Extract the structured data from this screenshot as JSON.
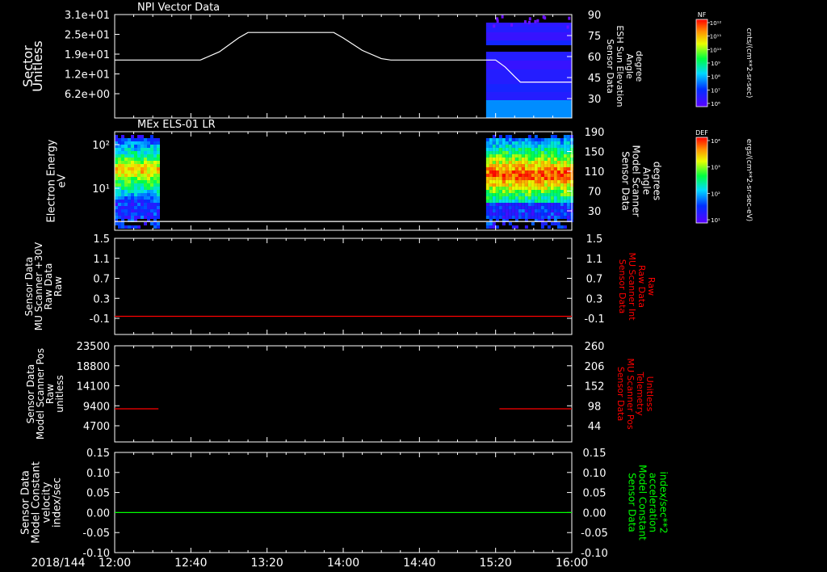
{
  "chart_data": [
    {
      "type": "line",
      "title": "NPI Vector Data",
      "ylabel_left": [
        "Sector",
        "Unitless"
      ],
      "ylabel_right": [
        "Sensor Data",
        "ESH Sun Elevation",
        "Angle",
        "degree"
      ],
      "yticks_left": [
        "3.1e+01",
        "2.5e+01",
        "1.9e+01",
        "1.2e+01",
        "6.2e+00"
      ],
      "yticks_right": [
        "90",
        "75",
        "60",
        "45",
        "30"
      ],
      "ylim_right": [
        15,
        90
      ],
      "series": [
        {
          "color": "#ffffff",
          "x": [
            "12:00",
            "12:35",
            "12:45",
            "12:55",
            "13:05",
            "13:10",
            "13:55",
            "14:00",
            "14:10",
            "14:20",
            "14:25",
            "15:20",
            "15:25",
            "15:30",
            "15:33",
            "16:00"
          ],
          "values": [
            57,
            57,
            57,
            63,
            73,
            77,
            77,
            73,
            64,
            58,
            57,
            57,
            52,
            45,
            41,
            41
          ]
        }
      ],
      "spectrogram": {
        "start": "15:15",
        "end": "16:00",
        "colorbar": "NF"
      },
      "colorbar": {
        "label": "NF",
        "ticks": [
          "10¹²",
          "10¹¹",
          "10¹⁰",
          "10⁹",
          "10⁸",
          "10⁷",
          "10⁶"
        ],
        "units": "cnts/(cm**2-sr-sec)"
      }
    },
    {
      "type": "heatmap",
      "title": "MEx ELS-01 LR",
      "ylabel_left": [
        "Electron Energy",
        "eV"
      ],
      "ylabel_right": [
        "Sensor Data",
        "Model Scanner",
        "Angle",
        "degrees"
      ],
      "yticks_left": [
        "10²",
        "10¹"
      ],
      "yticks_right": [
        "190",
        "150",
        "110",
        "70",
        "30"
      ],
      "ylim_right": [
        0,
        190
      ],
      "blocks": [
        {
          "start": "12:00",
          "end": "12:23"
        },
        {
          "start": "15:15",
          "end": "16:00"
        }
      ],
      "series": [
        {
          "color": "#ffffff",
          "x": [
            "12:00",
            "16:00"
          ],
          "values": [
            17,
            17
          ]
        }
      ],
      "colorbar": {
        "label": "DEF",
        "ticks": [
          "10⁴",
          "10³",
          "10²",
          "10¹"
        ],
        "units": "ergs/(cm**2-sr-sec-eV)"
      }
    },
    {
      "type": "line",
      "ylabel_left": [
        "Sensor Data",
        "MU Scanner +30V",
        "Raw Data",
        "Raw"
      ],
      "ylabel_right": [
        "Sensor Data",
        "MU Scanner Int",
        "Raw Data",
        "Raw"
      ],
      "ylabel_right_color": "#ff0000",
      "yticks_left": [
        "1.5",
        "1.1",
        "0.7",
        "0.3",
        "-0.1"
      ],
      "yticks_right": [
        "1.5",
        "1.1",
        "0.7",
        "0.3",
        "-0.1"
      ],
      "ylim": [
        -0.35,
        1.5
      ],
      "series": [
        {
          "color": "#ff0000",
          "x": [
            "12:00",
            "16:00"
          ],
          "values": [
            0,
            0
          ]
        }
      ]
    },
    {
      "type": "line",
      "ylabel_left": [
        "Sensor Data",
        "Model Scanner Pos",
        "Raw",
        "unitless"
      ],
      "ylabel_right": [
        "Sensor Data",
        "MU Scanner Pos",
        "Telemetry",
        "Unitless"
      ],
      "ylabel_right_color": "#ff0000",
      "yticks_left": [
        "23500",
        "18800",
        "14100",
        "9400",
        "4700"
      ],
      "yticks_right": [
        "260",
        "206",
        "152",
        "98",
        "44"
      ],
      "ylim": [
        0,
        23500
      ],
      "series": [
        {
          "color": "#ff0000",
          "x": [
            "12:00",
            "12:23"
          ],
          "values": [
            8100,
            8100
          ]
        },
        {
          "color": "#ff0000",
          "x": [
            "15:22",
            "16:00"
          ],
          "values": [
            8100,
            8100
          ]
        }
      ]
    },
    {
      "type": "line",
      "ylabel_left": [
        "Sensor Data",
        "Model Constant",
        "velocity",
        "index/sec"
      ],
      "ylabel_right": [
        "Sensor Data",
        "Model Constant",
        "acceleration",
        "index/sec**2"
      ],
      "ylabel_right_color": "#00ff00",
      "yticks_left": [
        "0.15",
        "0.10",
        "0.05",
        "0.00",
        "-0.05",
        "-0.10"
      ],
      "yticks_right": [
        "0.15",
        "0.10",
        "0.05",
        "0.00",
        "-0.05",
        "-0.10"
      ],
      "ylim": [
        -0.1,
        0.15
      ],
      "series": [
        {
          "color": "#00ff00",
          "x": [
            "12:00",
            "16:00"
          ],
          "values": [
            0,
            0
          ]
        }
      ]
    }
  ],
  "xaxis": {
    "date": "2018/144",
    "ticks": [
      "12:00",
      "12:40",
      "13:20",
      "14:00",
      "14:40",
      "15:20",
      "16:00"
    ],
    "range": [
      "12:00",
      "16:00"
    ]
  }
}
